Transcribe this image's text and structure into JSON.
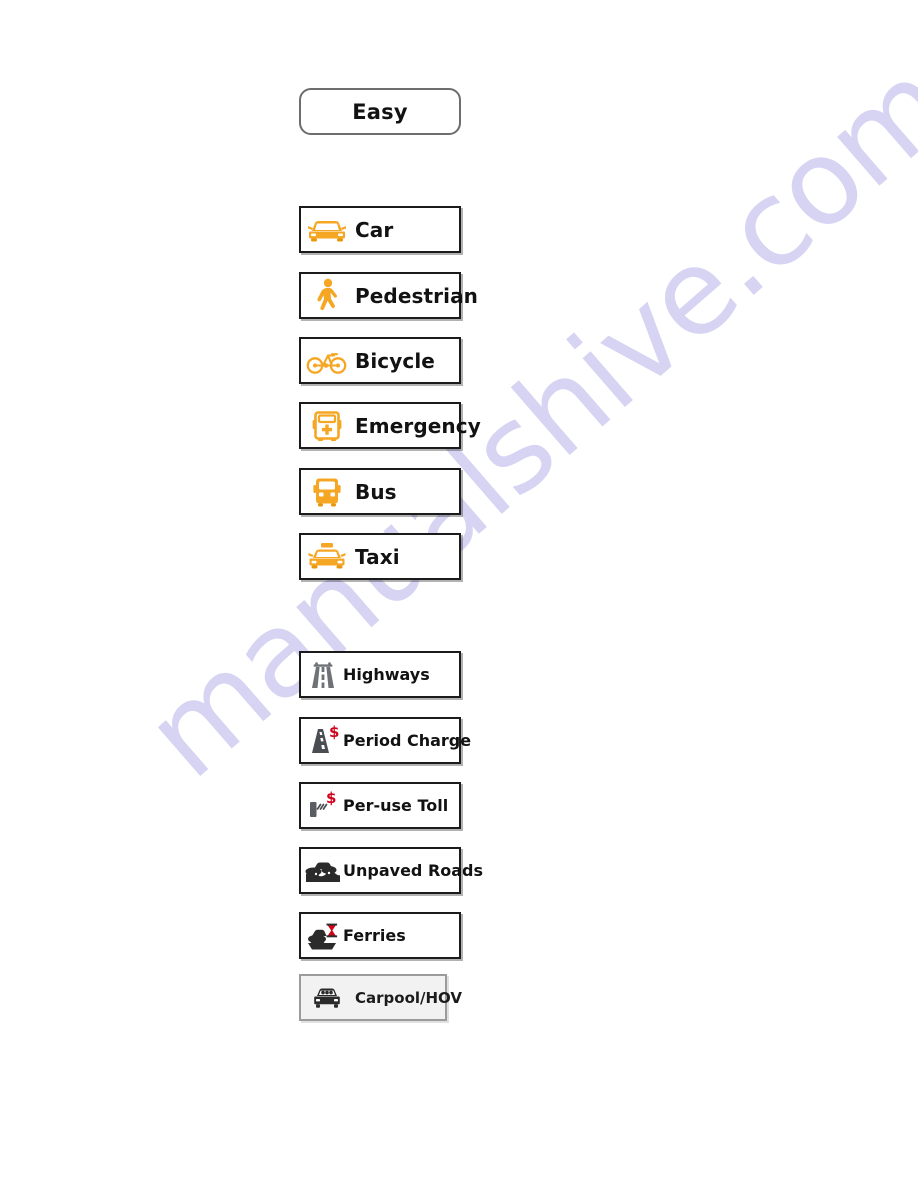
{
  "page": {
    "watermark_text": "manualshive.com",
    "background": "#ffffff"
  },
  "colors": {
    "icon_orange": "#F5A623",
    "icon_orange_dark": "#E8960C",
    "icon_gray": "#6E7175",
    "icon_dark": "#2B2B2B",
    "dollar_red": "#D0021B",
    "border_dark": "#1b1b1b",
    "border_gray": "#6d6d6d",
    "disabled_fill": "#f2f2f2",
    "text": "#121212"
  },
  "header": {
    "mode_button": {
      "label": "Easy",
      "name": "easy-mode-button",
      "enabled": true
    }
  },
  "vehicle_group": {
    "items": [
      {
        "label": "Car",
        "icon": "car-icon",
        "enabled": true
      },
      {
        "label": "Pedestrian",
        "icon": "pedestrian-icon",
        "enabled": true
      },
      {
        "label": "Bicycle",
        "icon": "bicycle-icon",
        "enabled": true
      },
      {
        "label": "Emergency",
        "icon": "ambulance-icon",
        "enabled": true
      },
      {
        "label": "Bus",
        "icon": "bus-icon",
        "enabled": true
      },
      {
        "label": "Taxi",
        "icon": "taxi-icon",
        "enabled": true
      }
    ]
  },
  "road_group": {
    "items": [
      {
        "label": "Highways",
        "icon": "highway-icon",
        "enabled": true
      },
      {
        "label": "Period Charge",
        "icon": "period-charge-icon",
        "enabled": true
      },
      {
        "label": "Per-use Toll",
        "icon": "toll-gate-icon",
        "enabled": true
      },
      {
        "label": "Unpaved Roads",
        "icon": "unpaved-road-icon",
        "enabled": true
      },
      {
        "label": "Ferries",
        "icon": "ferry-icon",
        "enabled": true
      },
      {
        "label": "Carpool/HOV",
        "icon": "carpool-icon",
        "enabled": false
      }
    ]
  }
}
